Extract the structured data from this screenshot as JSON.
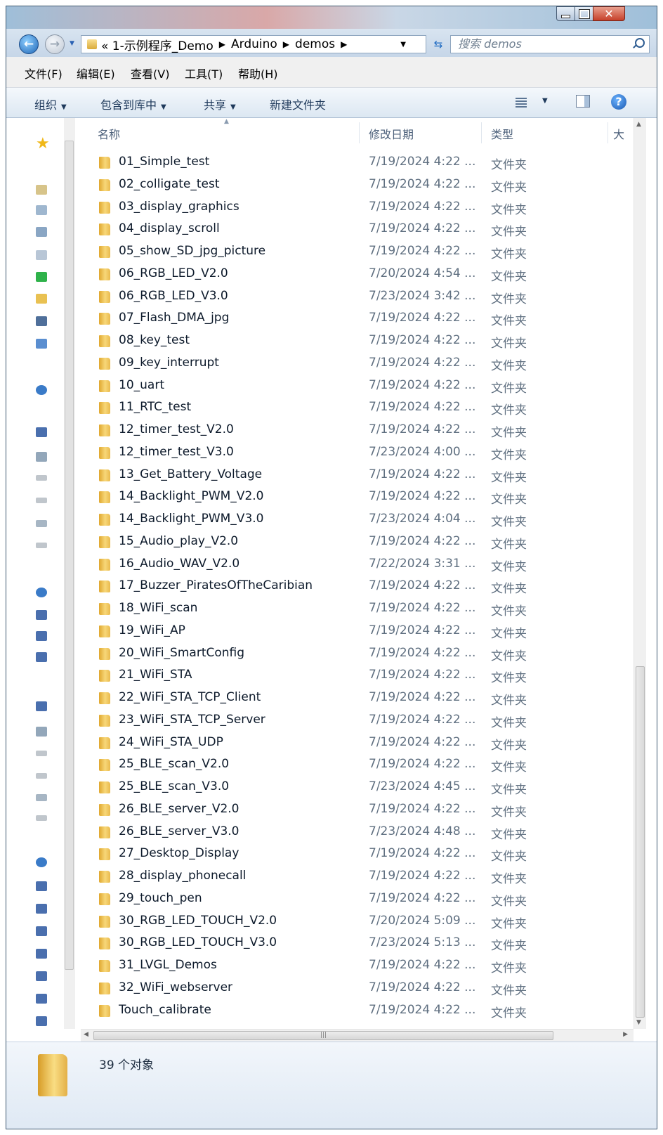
{
  "address": {
    "crumbs": [
      "« 1-示例程序_Demo",
      "Arduino",
      "demos"
    ],
    "search_placeholder": "搜索 demos"
  },
  "menubar": [
    "文件(F)",
    "编辑(E)",
    "查看(V)",
    "工具(T)",
    "帮助(H)"
  ],
  "commandbar": {
    "organize": "组织",
    "include_library": "包含到库中",
    "share": "共享",
    "new_folder": "新建文件夹"
  },
  "columns": {
    "name": "名称",
    "modified": "修改日期",
    "type": "类型",
    "size": "大"
  },
  "files": [
    {
      "name": "01_Simple_test",
      "date": "7/19/2024 4:22 ...",
      "type": "文件夹"
    },
    {
      "name": "02_colligate_test",
      "date": "7/19/2024 4:22 ...",
      "type": "文件夹"
    },
    {
      "name": "03_display_graphics",
      "date": "7/19/2024 4:22 ...",
      "type": "文件夹"
    },
    {
      "name": "04_display_scroll",
      "date": "7/19/2024 4:22 ...",
      "type": "文件夹"
    },
    {
      "name": "05_show_SD_jpg_picture",
      "date": "7/19/2024 4:22 ...",
      "type": "文件夹"
    },
    {
      "name": "06_RGB_LED_V2.0",
      "date": "7/20/2024 4:54 ...",
      "type": "文件夹"
    },
    {
      "name": "06_RGB_LED_V3.0",
      "date": "7/23/2024 3:42 ...",
      "type": "文件夹"
    },
    {
      "name": "07_Flash_DMA_jpg",
      "date": "7/19/2024 4:22 ...",
      "type": "文件夹"
    },
    {
      "name": "08_key_test",
      "date": "7/19/2024 4:22 ...",
      "type": "文件夹"
    },
    {
      "name": "09_key_interrupt",
      "date": "7/19/2024 4:22 ...",
      "type": "文件夹"
    },
    {
      "name": "10_uart",
      "date": "7/19/2024 4:22 ...",
      "type": "文件夹"
    },
    {
      "name": "11_RTC_test",
      "date": "7/19/2024 4:22 ...",
      "type": "文件夹"
    },
    {
      "name": "12_timer_test_V2.0",
      "date": "7/19/2024 4:22 ...",
      "type": "文件夹"
    },
    {
      "name": "12_timer_test_V3.0",
      "date": "7/23/2024 4:00 ...",
      "type": "文件夹"
    },
    {
      "name": "13_Get_Battery_Voltage",
      "date": "7/19/2024 4:22 ...",
      "type": "文件夹"
    },
    {
      "name": "14_Backlight_PWM_V2.0",
      "date": "7/19/2024 4:22 ...",
      "type": "文件夹"
    },
    {
      "name": "14_Backlight_PWM_V3.0",
      "date": "7/23/2024 4:04 ...",
      "type": "文件夹"
    },
    {
      "name": "15_Audio_play_V2.0",
      "date": "7/19/2024 4:22 ...",
      "type": "文件夹"
    },
    {
      "name": "16_Audio_WAV_V2.0",
      "date": "7/22/2024 3:31 ...",
      "type": "文件夹"
    },
    {
      "name": "17_Buzzer_PiratesOfTheCaribian",
      "date": "7/19/2024 4:22 ...",
      "type": "文件夹"
    },
    {
      "name": "18_WiFi_scan",
      "date": "7/19/2024 4:22 ...",
      "type": "文件夹"
    },
    {
      "name": "19_WiFi_AP",
      "date": "7/19/2024 4:22 ...",
      "type": "文件夹"
    },
    {
      "name": "20_WiFi_SmartConfig",
      "date": "7/19/2024 4:22 ...",
      "type": "文件夹"
    },
    {
      "name": "21_WiFi_STA",
      "date": "7/19/2024 4:22 ...",
      "type": "文件夹"
    },
    {
      "name": "22_WiFi_STA_TCP_Client",
      "date": "7/19/2024 4:22 ...",
      "type": "文件夹"
    },
    {
      "name": "23_WiFi_STA_TCP_Server",
      "date": "7/19/2024 4:22 ...",
      "type": "文件夹"
    },
    {
      "name": "24_WiFi_STA_UDP",
      "date": "7/19/2024 4:22 ...",
      "type": "文件夹"
    },
    {
      "name": "25_BLE_scan_V2.0",
      "date": "7/19/2024 4:22 ...",
      "type": "文件夹"
    },
    {
      "name": "25_BLE_scan_V3.0",
      "date": "7/23/2024 4:45 ...",
      "type": "文件夹"
    },
    {
      "name": "26_BLE_server_V2.0",
      "date": "7/19/2024 4:22 ...",
      "type": "文件夹"
    },
    {
      "name": "26_BLE_server_V3.0",
      "date": "7/23/2024 4:48 ...",
      "type": "文件夹"
    },
    {
      "name": "27_Desktop_Display",
      "date": "7/19/2024 4:22 ...",
      "type": "文件夹"
    },
    {
      "name": "28_display_phonecall",
      "date": "7/19/2024 4:22 ...",
      "type": "文件夹"
    },
    {
      "name": "29_touch_pen",
      "date": "7/19/2024 4:22 ...",
      "type": "文件夹"
    },
    {
      "name": "30_RGB_LED_TOUCH_V2.0",
      "date": "7/20/2024 5:09 ...",
      "type": "文件夹"
    },
    {
      "name": "30_RGB_LED_TOUCH_V3.0",
      "date": "7/23/2024 5:13 ...",
      "type": "文件夹"
    },
    {
      "name": "31_LVGL_Demos",
      "date": "7/19/2024 4:22 ...",
      "type": "文件夹"
    },
    {
      "name": "32_WiFi_webserver",
      "date": "7/19/2024 4:22 ...",
      "type": "文件夹"
    },
    {
      "name": "Touch_calibrate",
      "date": "7/19/2024 4:22 ...",
      "type": "文件夹"
    }
  ],
  "status": {
    "count_text": "39 个对象"
  },
  "colors": {
    "folder": "#f2c85a",
    "accent": "#1e6bc2"
  }
}
